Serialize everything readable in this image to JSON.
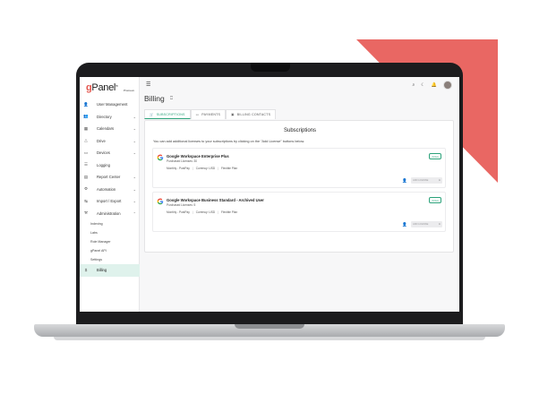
{
  "colors": {
    "accent_red": "#e4574f",
    "accent_green": "#2ba27a"
  },
  "logo": {
    "brand": "gPanel",
    "brand_mark": "by",
    "vendor": "Promevo"
  },
  "topbar": {
    "menu_icon": "menu-icon",
    "icons": [
      "search-icon",
      "moon-icon",
      "bell-icon",
      "avatar"
    ]
  },
  "sidebar": {
    "items": [
      {
        "icon": "user-icon",
        "label": "User Management",
        "chevron": ""
      },
      {
        "icon": "directory-icon",
        "label": "Directory",
        "chevron": "⌄"
      },
      {
        "icon": "calendar-icon",
        "label": "Calendars",
        "chevron": "⌄"
      },
      {
        "icon": "drive-icon",
        "label": "Drive",
        "chevron": "⌄"
      },
      {
        "icon": "devices-icon",
        "label": "Devices",
        "chevron": "⌄"
      },
      {
        "icon": "logging-icon",
        "label": "Logging",
        "chevron": ""
      },
      {
        "icon": "report-icon",
        "label": "Report Center",
        "chevron": "⌄"
      },
      {
        "icon": "automation-icon",
        "label": "Automation",
        "chevron": "⌄"
      },
      {
        "icon": "import-export-icon",
        "label": "Import / Export",
        "chevron": "⌄"
      },
      {
        "icon": "admin-icon",
        "label": "Administration",
        "chevron": "⌃"
      }
    ],
    "sub_items": [
      "Indexing",
      "Labs",
      "Role Manager",
      "gPanel API",
      "Settings"
    ],
    "active": {
      "icon": "dollar-icon",
      "label": "Billing"
    }
  },
  "page": {
    "title": "Billing"
  },
  "tabs": [
    {
      "label": "SUBSCRIPTIONS",
      "icon": "cart-icon"
    },
    {
      "label": "PAYMENTS",
      "icon": "card-icon"
    },
    {
      "label": "BILLING CONTACTS",
      "icon": "contacts-icon"
    }
  ],
  "card": {
    "title": "Subscriptions",
    "note": "You can add additional licenses to your subscriptions by clicking on the \"Add License\" buttons below."
  },
  "subscriptions": [
    {
      "name": "Google Workspace Enterprise Plus",
      "licenses": "Purchased Licenses: 30",
      "status": "Active",
      "terms": [
        "Monthly - PostPay",
        "Currency: USD",
        "Flexible Plan"
      ],
      "button": "ADD LICENSE"
    },
    {
      "name": "Google Workspace Business Standard - Archived User",
      "licenses": "Purchased Licenses: 5",
      "status": "Active",
      "terms": [
        "Monthly - PostPay",
        "Currency: USD",
        "Flexible Plan"
      ],
      "button": "ADD LICENSE"
    }
  ]
}
